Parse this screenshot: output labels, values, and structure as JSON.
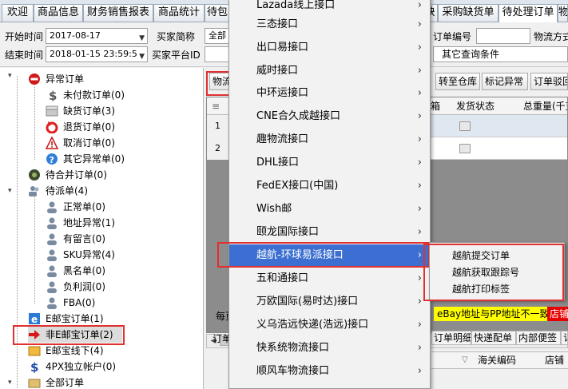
{
  "tabs": {
    "items": [
      {
        "label": "欢迎"
      },
      {
        "label": "商品信息"
      },
      {
        "label": "财务销售报表"
      },
      {
        "label": "商品统计"
      },
      {
        "label": "待包"
      },
      {
        "label": "缺"
      },
      {
        "label": "采购缺货单"
      },
      {
        "label": "待处理订单"
      },
      {
        "label": "物"
      }
    ]
  },
  "filters": {
    "start_time_label": "开始时间",
    "start_time_value": "2017-08-17",
    "end_time_label": "结束时间",
    "end_time_value": "2018-01-15 23:59:5",
    "buyer_short_label": "买家简称",
    "buyer_short_value": "全部",
    "buyer_platform_label": "买家平台ID",
    "buyer_platform_value": "",
    "order_no_label": "订单编号",
    "order_no_value": "",
    "logistics_label": "物流方式",
    "other_query_value": "其它查询条件"
  },
  "tree": {
    "items": [
      {
        "label": "异常订单",
        "icon": "no-entry-icon"
      },
      {
        "label": "未付款订单(0)",
        "icon": "dollar-icon"
      },
      {
        "label": "缺货订单(3)",
        "icon": "box-icon"
      },
      {
        "label": "退货订单(0)",
        "icon": "return-icon"
      },
      {
        "label": "取消订单(0)",
        "icon": "warning-icon"
      },
      {
        "label": "其它异常单(0)",
        "icon": "question-icon"
      },
      {
        "label": "待合并订单(0)",
        "icon": "gear-icon"
      },
      {
        "label": "待派单(4)",
        "icon": "users-icon"
      },
      {
        "label": "正常单(0)",
        "icon": "user-icon"
      },
      {
        "label": "地址异常(1)",
        "icon": "user-icon"
      },
      {
        "label": "有留言(0)",
        "icon": "user-icon"
      },
      {
        "label": "SKU异常(4)",
        "icon": "user-icon"
      },
      {
        "label": "黑名单(0)",
        "icon": "user-icon"
      },
      {
        "label": "负利润(0)",
        "icon": "user-icon"
      },
      {
        "label": "FBA(0)",
        "icon": "user-icon"
      },
      {
        "label": "E邮宝订单(1)",
        "icon": "e-icon"
      },
      {
        "label": "非E邮宝订单(2)",
        "icon": "arrow-right-icon"
      },
      {
        "label": "E邮宝线下(4)",
        "icon": "folder-icon"
      },
      {
        "label": "4PX独立帐户(0)",
        "icon": "dollar-icon"
      },
      {
        "label": "全部订单",
        "icon": "box-icon"
      }
    ]
  },
  "toolbar": {
    "logistics_button": "物流",
    "to_warehouse_button": "转至仓库",
    "mark_exception_button": "标记异常",
    "order_review_button": "订单驳回"
  },
  "grid": {
    "headers": [
      "箱",
      "发货状态",
      "总重量(千克"
    ],
    "row_numbers": [
      "1",
      "2"
    ]
  },
  "below_grid": {
    "per_page_label": "每页",
    "warning_yellow": "eBay地址与PP地址不一致",
    "warning_red": "店铺E"
  },
  "bottom_tabs": {
    "left_label": "订单",
    "items": [
      "订单明细",
      "快递配单",
      "内部便签",
      "订单"
    ],
    "columns": [
      "海关编码",
      "店铺"
    ]
  },
  "menu": {
    "items": [
      {
        "label": "Lazada线上接口"
      },
      {
        "label": "三态接口"
      },
      {
        "label": "出口易接口"
      },
      {
        "label": "威时接口"
      },
      {
        "label": "中环运接口"
      },
      {
        "label": "CNE合久成越接口"
      },
      {
        "label": "趣物流接口"
      },
      {
        "label": "DHL接口"
      },
      {
        "label": "FedEX接口(中国)"
      },
      {
        "label": "Wish邮"
      },
      {
        "label": "颐龙国际接口"
      },
      {
        "label": "越航-环球易派接口"
      },
      {
        "label": "五和通接口"
      },
      {
        "label": "万欧国际(易时达)接口"
      },
      {
        "label": "义乌浩远快递(浩远)接口"
      },
      {
        "label": "快系统物流接口"
      },
      {
        "label": "顺风车物流接口"
      }
    ],
    "highlighted": "越航-环球易派接口"
  },
  "submenu": {
    "items": [
      {
        "label": "越航提交订单"
      },
      {
        "label": "越航获取跟踪号"
      },
      {
        "label": "越航打印标签"
      }
    ]
  },
  "colors": {
    "menu_highlight": "#3c6fd1",
    "annotation_red": "#e03030",
    "warning_yellow": "#ffff00",
    "warning_red": "#e60000"
  }
}
